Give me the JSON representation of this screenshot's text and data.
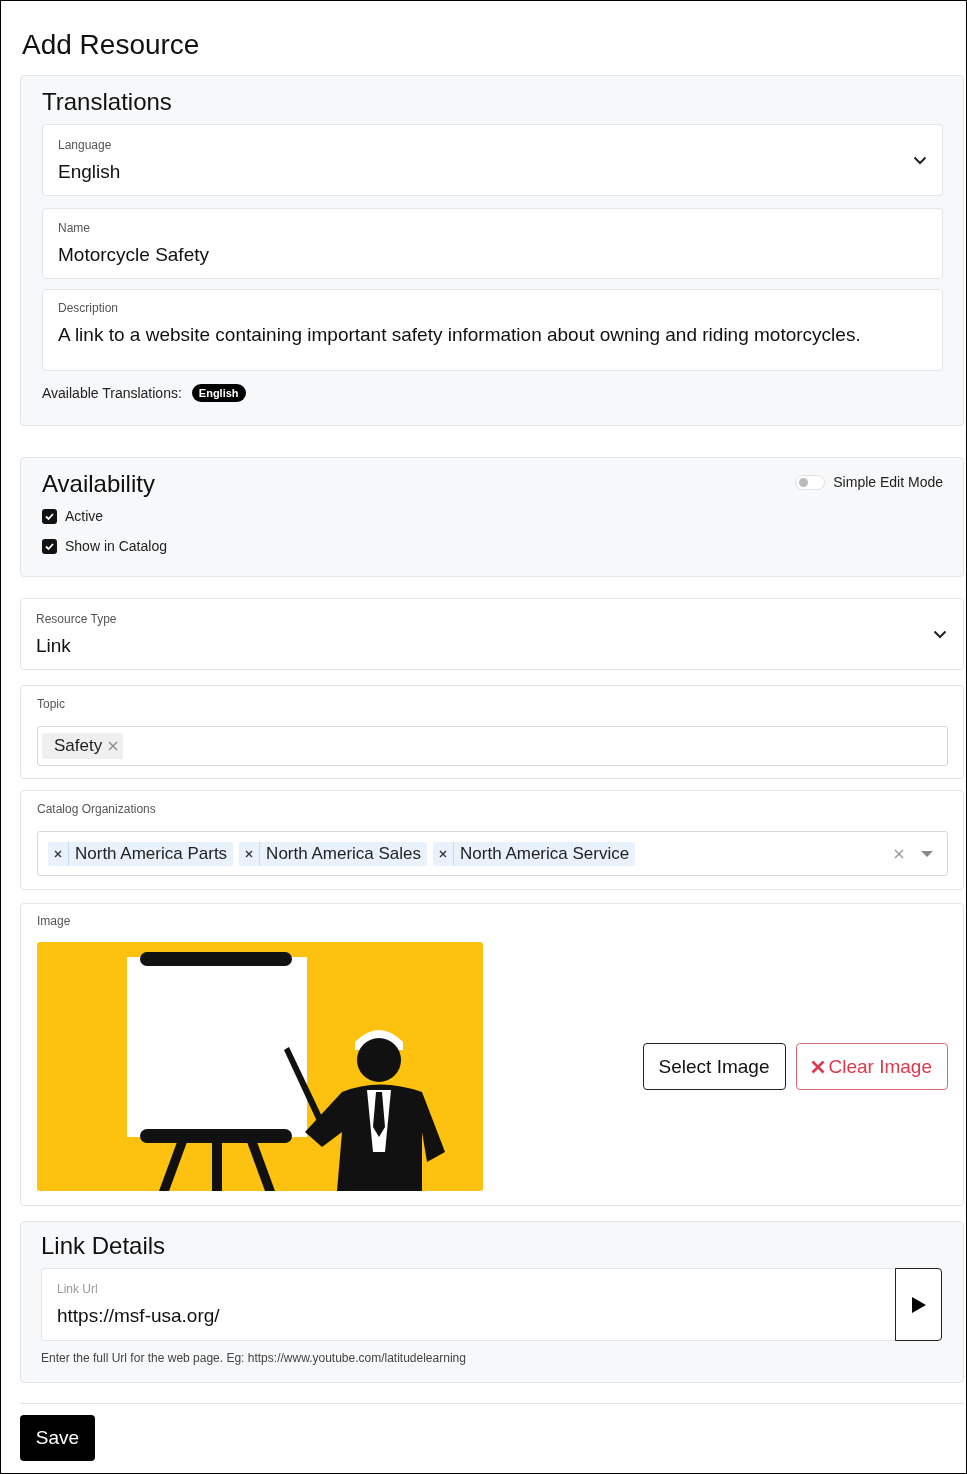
{
  "page": {
    "title": "Add Resource"
  },
  "translations": {
    "title": "Translations",
    "language": {
      "label": "Language",
      "value": "English"
    },
    "name": {
      "label": "Name",
      "value": "Motorcycle Safety"
    },
    "description": {
      "label": "Description",
      "value": "A link to a website containing important safety information about owning and riding motorcycles."
    },
    "available_label": "Available Translations:",
    "available": [
      "English"
    ]
  },
  "availability": {
    "title": "Availability",
    "simple_edit_mode": {
      "label": "Simple Edit Mode",
      "on": false
    },
    "options": [
      {
        "label": "Active",
        "checked": true
      },
      {
        "label": "Show in Catalog",
        "checked": true
      }
    ]
  },
  "resource_type": {
    "label": "Resource Type",
    "value": "Link"
  },
  "topic": {
    "label": "Topic",
    "tags": [
      "Safety"
    ]
  },
  "catalog_organizations": {
    "label": "Catalog Organizations",
    "tags": [
      "North America Parts",
      "North America Sales",
      "North America Service"
    ]
  },
  "image": {
    "label": "Image",
    "select_button": "Select Image",
    "clear_button": "Clear Image"
  },
  "link_details": {
    "title": "Link Details",
    "url": {
      "label": "Link Url",
      "value": "https://msf-usa.org/"
    },
    "hint": "Enter the full Url for the web page. Eg: https://www.youtube.com/latitudelearning"
  },
  "save_button": "Save"
}
